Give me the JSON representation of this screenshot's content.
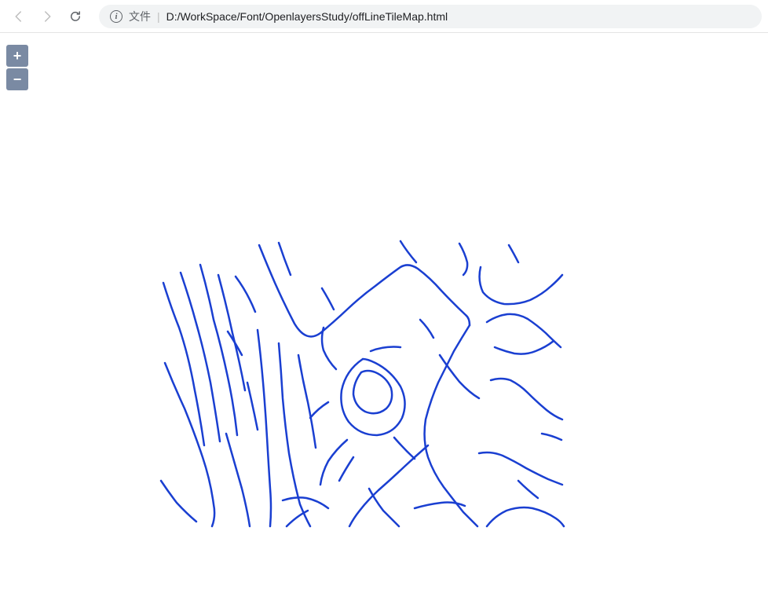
{
  "browser": {
    "file_label": "文件",
    "separator": "|",
    "url": "D:/WorkSpace/Font/OpenlayersStudy/offLineTileMap.html"
  },
  "map": {
    "zoom_in_label": "+",
    "zoom_out_label": "−"
  }
}
